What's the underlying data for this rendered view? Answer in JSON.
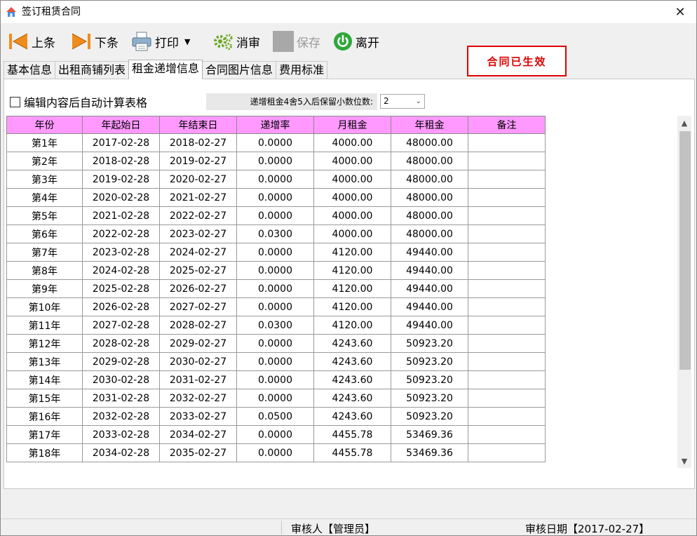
{
  "window": {
    "title": "签订租赁合同",
    "close": "✕"
  },
  "toolbar": {
    "prev": "上条",
    "next": "下条",
    "print": "打印",
    "cancel_audit": "消审",
    "save": "保存",
    "exit": "离开"
  },
  "status": "合同已生效",
  "tabs": [
    "基本信息",
    "出租商铺列表",
    "租金递增信息",
    "合同图片信息",
    "费用标准"
  ],
  "options": {
    "auto_calc_label": "编辑内容后自动计算表格",
    "decimals_label": "递增租金4舍5入后保留小数位数:",
    "decimals_value": "2"
  },
  "table": {
    "headers": [
      "年份",
      "年起始日",
      "年结束日",
      "递增率",
      "月租金",
      "年租金",
      "备注"
    ],
    "rows": [
      [
        "第1年",
        "2017-02-28",
        "2018-02-27",
        "0.0000",
        "4000.00",
        "48000.00",
        ""
      ],
      [
        "第2年",
        "2018-02-28",
        "2019-02-27",
        "0.0000",
        "4000.00",
        "48000.00",
        ""
      ],
      [
        "第3年",
        "2019-02-28",
        "2020-02-27",
        "0.0000",
        "4000.00",
        "48000.00",
        ""
      ],
      [
        "第4年",
        "2020-02-28",
        "2021-02-27",
        "0.0000",
        "4000.00",
        "48000.00",
        ""
      ],
      [
        "第5年",
        "2021-02-28",
        "2022-02-27",
        "0.0000",
        "4000.00",
        "48000.00",
        ""
      ],
      [
        "第6年",
        "2022-02-28",
        "2023-02-27",
        "0.0300",
        "4000.00",
        "48000.00",
        ""
      ],
      [
        "第7年",
        "2023-02-28",
        "2024-02-27",
        "0.0000",
        "4120.00",
        "49440.00",
        ""
      ],
      [
        "第8年",
        "2024-02-28",
        "2025-02-27",
        "0.0000",
        "4120.00",
        "49440.00",
        ""
      ],
      [
        "第9年",
        "2025-02-28",
        "2026-02-27",
        "0.0000",
        "4120.00",
        "49440.00",
        ""
      ],
      [
        "第10年",
        "2026-02-28",
        "2027-02-27",
        "0.0000",
        "4120.00",
        "49440.00",
        ""
      ],
      [
        "第11年",
        "2027-02-28",
        "2028-02-27",
        "0.0300",
        "4120.00",
        "49440.00",
        ""
      ],
      [
        "第12年",
        "2028-02-28",
        "2029-02-27",
        "0.0000",
        "4243.60",
        "50923.20",
        ""
      ],
      [
        "第13年",
        "2029-02-28",
        "2030-02-27",
        "0.0000",
        "4243.60",
        "50923.20",
        ""
      ],
      [
        "第14年",
        "2030-02-28",
        "2031-02-27",
        "0.0000",
        "4243.60",
        "50923.20",
        ""
      ],
      [
        "第15年",
        "2031-02-28",
        "2032-02-27",
        "0.0000",
        "4243.60",
        "50923.20",
        ""
      ],
      [
        "第16年",
        "2032-02-28",
        "2033-02-27",
        "0.0500",
        "4243.60",
        "50923.20",
        ""
      ],
      [
        "第17年",
        "2033-02-28",
        "2034-02-27",
        "0.0000",
        "4455.78",
        "53469.36",
        ""
      ],
      [
        "第18年",
        "2034-02-28",
        "2035-02-27",
        "0.0000",
        "4455.78",
        "53469.36",
        ""
      ]
    ]
  },
  "footer": {
    "auditor": "审核人【管理员】",
    "audit_date": "审核日期【2017-02-27】"
  },
  "colors": {
    "header_bg": "#ff99ff",
    "status_red": "#e00000",
    "arrow_orange": "#f08c1c",
    "gear_green": "#6aa823",
    "exit_green": "#2ea83a"
  }
}
